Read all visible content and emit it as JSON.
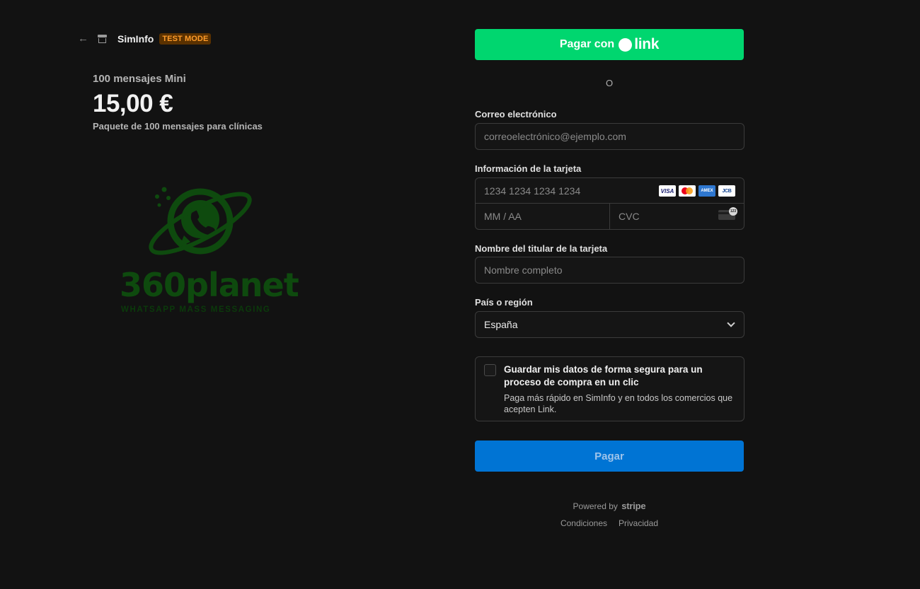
{
  "header": {
    "back_icon": "arrow-left-icon",
    "store_icon": "store-icon",
    "merchant_name": "SimInfo",
    "test_badge": "TEST MODE"
  },
  "product": {
    "name": "100 mensajes Mini",
    "price": "15,00 €",
    "description": "Paquete de 100 mensajes para clínicas"
  },
  "logo": {
    "title": "360planet",
    "subtitle": "WHATSAPP MASS MESSAGING",
    "color": "#0e4a0e"
  },
  "link_button": {
    "label": "Pagar con",
    "brand": "link",
    "color": "#00d66f"
  },
  "separator": "O",
  "email": {
    "label": "Correo electrónico",
    "placeholder": "correoelectrónico@ejemplo.com"
  },
  "card": {
    "label": "Información de la tarjeta",
    "number_placeholder": "1234 1234 1234 1234",
    "expiry_placeholder": "MM / AA",
    "cvc_placeholder": "CVC",
    "brands": [
      "VISA",
      "mastercard",
      "AMEX",
      "JCB"
    ]
  },
  "cardholder": {
    "label": "Nombre del titular de la tarjeta",
    "placeholder": "Nombre completo"
  },
  "country": {
    "label": "País o región",
    "value": "España"
  },
  "save_info": {
    "title": "Guardar mis datos de forma segura para un proceso de compra en un clic",
    "description": "Paga más rápido en SimInfo y en todos los comercios que acepten Link."
  },
  "pay_button": {
    "label": "Pagar",
    "color": "#0074d4"
  },
  "footer": {
    "powered_by": "Powered by",
    "stripe": "stripe",
    "terms": "Condiciones",
    "privacy": "Privacidad"
  }
}
